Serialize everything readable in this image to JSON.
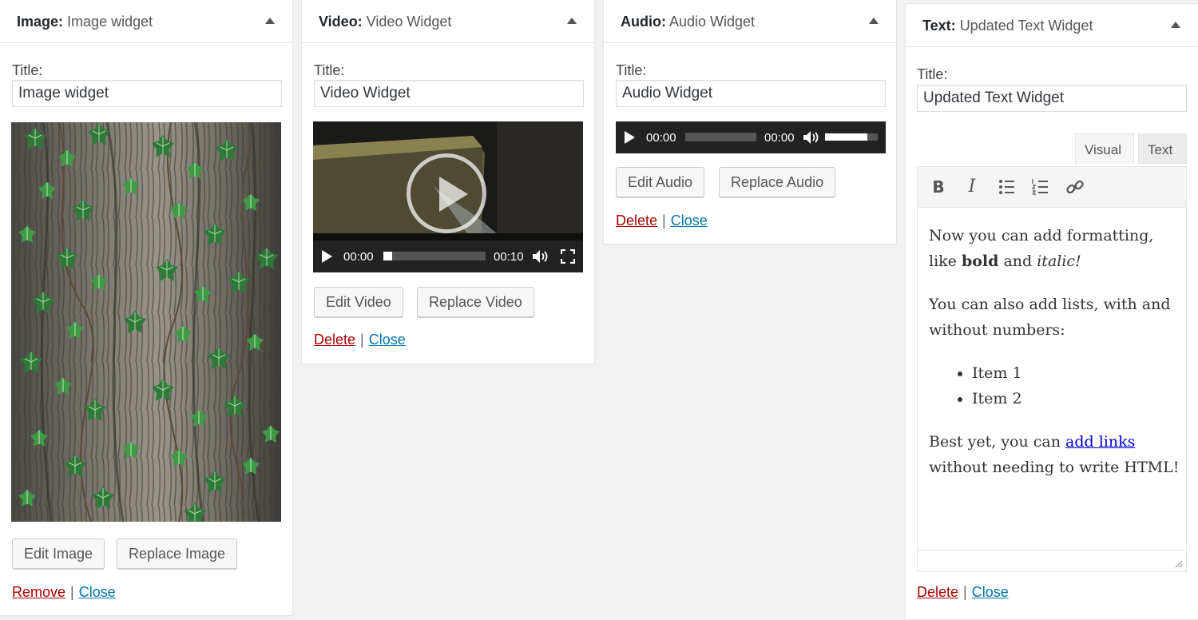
{
  "image_widget": {
    "type": "Image:",
    "instance": "Image widget",
    "title_label": "Title:",
    "title_value": "Image widget",
    "edit_label": "Edit Image",
    "replace_label": "Replace Image",
    "remove_label": "Remove",
    "close_label": "Close",
    "separator": "|"
  },
  "video_widget": {
    "type": "Video:",
    "instance": "Video Widget",
    "title_label": "Title:",
    "title_value": "Video Widget",
    "current_time": "00:00",
    "duration": "00:10",
    "edit_label": "Edit Video",
    "replace_label": "Replace Video",
    "delete_label": "Delete",
    "close_label": "Close",
    "separator": "|"
  },
  "audio_widget": {
    "type": "Audio:",
    "instance": "Audio Widget",
    "title_label": "Title:",
    "title_value": "Audio Widget",
    "current_time": "00:00",
    "duration": "00:00",
    "volume_level": 0.8,
    "edit_label": "Edit Audio",
    "replace_label": "Replace Audio",
    "delete_label": "Delete",
    "close_label": "Close",
    "separator": "|"
  },
  "text_widget": {
    "type": "Text:",
    "instance": "Updated Text Widget",
    "title_label": "Title:",
    "title_value": "Updated Text Widget",
    "tab_visual": "Visual",
    "tab_text": "Text",
    "toolbar": {
      "bold": "B",
      "italic": "I"
    },
    "content": {
      "p1_a": "Now you can add formatting, like ",
      "p1_bold": "bold",
      "p1_b": " and ",
      "p1_italic": "italic!",
      "p2": "You can also add lists, with and without numbers:",
      "list": [
        "Item 1",
        "Item 2"
      ],
      "p3_a": "Best yet, you can ",
      "p3_link": "add links",
      "p3_b": " without needing to write HTML!"
    },
    "delete_label": "Delete",
    "close_label": "Close",
    "separator": "|"
  },
  "icons": [
    "collapse-arrow-icon",
    "play-icon",
    "volume-icon",
    "fullscreen-icon",
    "bold-icon",
    "italic-icon",
    "bullet-list-icon",
    "numbered-list-icon",
    "link-icon",
    "resize-handle-icon"
  ],
  "colors": {
    "danger_link": "#aa0000",
    "close_link": "#0073aa",
    "player_bg": "#222222",
    "page_bg": "#f1f1f1"
  }
}
